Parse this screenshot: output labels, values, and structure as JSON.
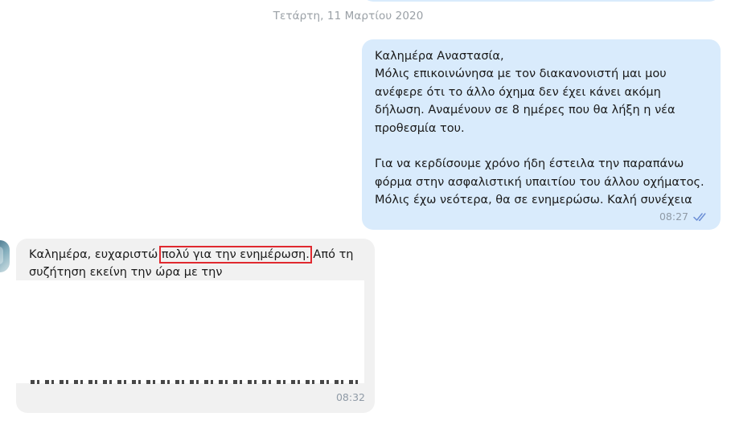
{
  "date_separator": "Τετάρτη, 11 Μαρτίου 2020",
  "outgoing": {
    "text": "Καλημέρα Αναστασία,\nΜόλις επικοινώνησα με τον διακανονιστή μαι μου ανέφερε ότι το άλλο όχημα δεν έχει κάνει ακόμη δήλωση. Αναμένουν σε 8 ημέρες που θα λήξη η νέα προθεσμία του.\n\nΓια να κερδίσουμε χρόνο ήδη έστειλα την παραπάνω φόρμα στην ασφαλιστική υπαιτίου του άλλου οχήματος. Μόλις έχω νεότερα, θα σε ενημερώσω. Καλή συνέχεια",
    "time": "08:27",
    "status_icon": "double-check-read-icon",
    "bubble_color": "#d9ebfc",
    "tick_color": "#6c8fd6"
  },
  "incoming": {
    "text_before": "Καλημέρα, ευχαριστώ ",
    "text_highlight": "πολύ για την ενημέρωση.",
    "text_after": " Από τη συζήτηση εκείνη την ώρα με την",
    "time": "08:32",
    "bubble_color": "#f1f1f1",
    "highlight_color": "#e0292f"
  },
  "avatar": {
    "icon": "contact-avatar"
  }
}
